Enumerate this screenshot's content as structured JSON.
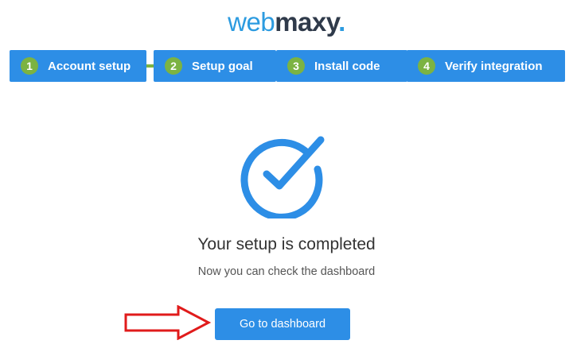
{
  "logo": {
    "part1": "web",
    "part2": "maxy",
    "part3": "."
  },
  "steps": [
    {
      "num": "1",
      "label": "Account setup"
    },
    {
      "num": "2",
      "label": "Setup goal"
    },
    {
      "num": "3",
      "label": "Install code"
    },
    {
      "num": "4",
      "label": "Verify integration"
    }
  ],
  "status": {
    "icon": "check-circle-icon",
    "title": "Your setup is completed",
    "subtitle": "Now you can check the dashboard"
  },
  "action": {
    "button_label": "Go to dashboard",
    "pointer_icon": "red-outline-arrow-icon"
  },
  "colors": {
    "primary": "#2d8ee6",
    "step_number_bg": "#7cb342",
    "logo_dark": "#2f3a4a",
    "arrow": "#e01b1b"
  }
}
